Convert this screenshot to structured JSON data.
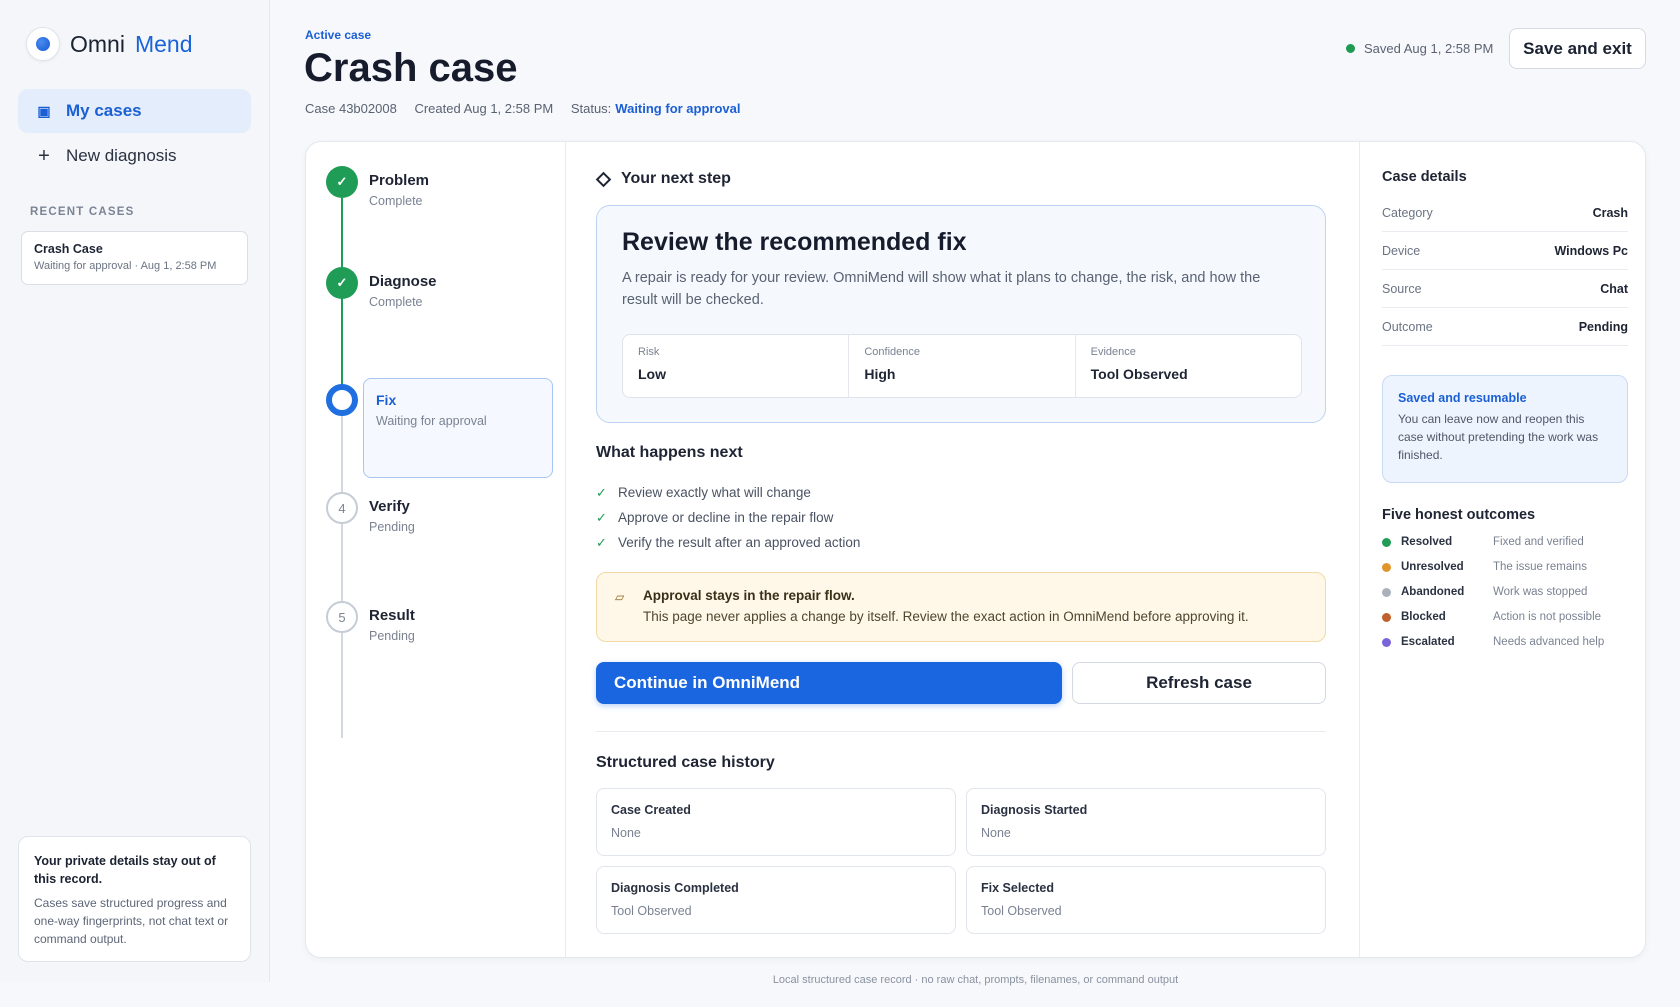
{
  "brand": {
    "name_a": "Omni",
    "name_b": "Mend"
  },
  "nav": [
    {
      "label": "My cases",
      "icon": "folder-icon",
      "active": true
    },
    {
      "label": "New diagnosis",
      "icon": "plus-icon",
      "active": false
    }
  ],
  "recent": {
    "label": "RECENT CASES",
    "items": [
      {
        "title": "Crash Case",
        "sub": "Waiting for approval · Aug 1, 2:58 PM"
      }
    ]
  },
  "privacy": {
    "title": "Your private details stay out of this record.",
    "text": "Cases save structured progress and one-way fingerprints, not chat text or command output."
  },
  "header": {
    "eyebrow": "Active case",
    "title": "Crash case",
    "case_id": "Case 43b02008",
    "created": "Created Aug 1, 2:58 PM",
    "status_label": "Status:",
    "status": "Waiting for approval",
    "saved": "Saved Aug 1, 2:58 PM",
    "save_exit": "Save and exit",
    "saved_color": "#1e9a53"
  },
  "steps": [
    {
      "title": "Problem",
      "sub": "Complete",
      "state": "done",
      "mark": "✓"
    },
    {
      "title": "Diagnose",
      "sub": "Complete",
      "state": "done",
      "mark": "✓"
    },
    {
      "title": "Fix",
      "sub": "Waiting for approval",
      "state": "current",
      "mark": ""
    },
    {
      "title": "Verify",
      "sub": "Pending",
      "state": "pending",
      "mark": "4"
    },
    {
      "title": "Result",
      "sub": "Pending",
      "state": "pending",
      "mark": "5"
    }
  ],
  "next_step": {
    "label": "Your next step",
    "heading": "Review the recommended fix",
    "text": "A repair is ready for your review. OmniMend will show what it plans to change, the risk, and how the result will be checked.",
    "metrics": [
      {
        "label": "Risk",
        "value": "Low"
      },
      {
        "label": "Confidence",
        "value": "High"
      },
      {
        "label": "Evidence",
        "value": "Tool Observed"
      }
    ]
  },
  "what_next": {
    "title": "What happens next",
    "items": [
      "Review exactly what will change",
      "Approve or decline in the repair flow",
      "Verify the result after an approved action"
    ]
  },
  "approval": {
    "title": "Approval stays in the repair flow.",
    "text": "This page never applies a change by itself. Review the exact action in OmniMend before approving it."
  },
  "actions": {
    "primary": "Continue in OmniMend",
    "secondary": "Refresh case"
  },
  "history": {
    "title": "Structured case history",
    "items": [
      {
        "title": "Case Created",
        "value": "None"
      },
      {
        "title": "Diagnosis Started",
        "value": "None"
      },
      {
        "title": "Diagnosis Completed",
        "value": "Tool Observed"
      },
      {
        "title": "Fix Selected",
        "value": "Tool Observed"
      }
    ]
  },
  "details": {
    "title": "Case details",
    "rows": [
      {
        "key": "Category",
        "value": "Crash"
      },
      {
        "key": "Device",
        "value": "Windows Pc"
      },
      {
        "key": "Source",
        "value": "Chat"
      },
      {
        "key": "Outcome",
        "value": "Pending"
      }
    ]
  },
  "resumable": {
    "title": "Saved and resumable",
    "text": "You can leave now and reopen this case without pretending the work was finished."
  },
  "outcomes": {
    "title": "Five honest outcomes",
    "items": [
      {
        "name": "Resolved",
        "desc": "Fixed and verified",
        "color": "#1f9c55"
      },
      {
        "name": "Unresolved",
        "desc": "The issue remains",
        "color": "#e0952a"
      },
      {
        "name": "Abandoned",
        "desc": "Work was stopped",
        "color": "#aab1bd"
      },
      {
        "name": "Blocked",
        "desc": "Action is not possible",
        "color": "#c0602c"
      },
      {
        "name": "Escalated",
        "desc": "Needs advanced help",
        "color": "#7b64d8"
      }
    ]
  },
  "footer": "Local structured case record · no raw chat, prompts, filenames, or command output"
}
